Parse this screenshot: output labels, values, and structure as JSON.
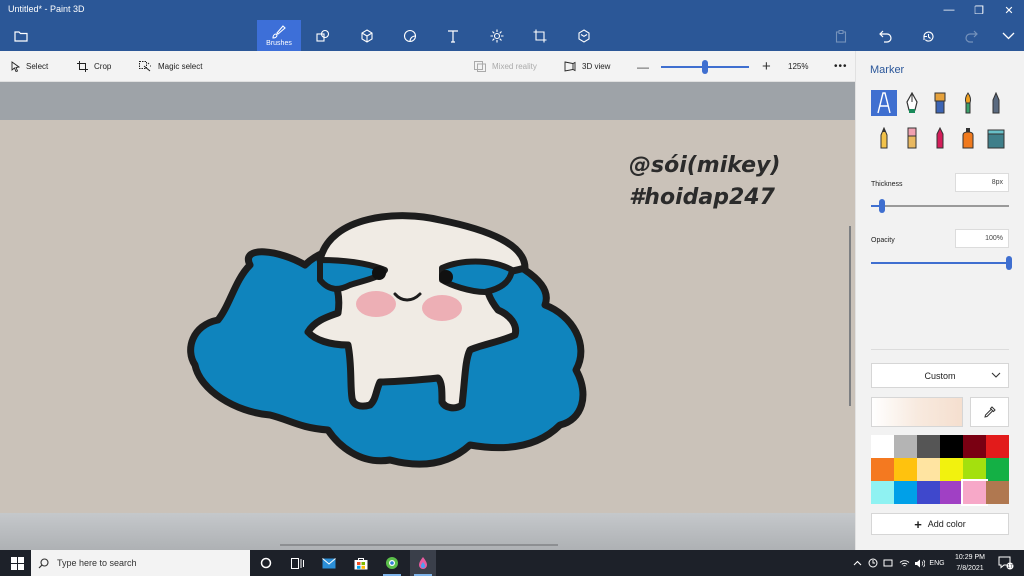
{
  "window": {
    "title": "Untitled* - Paint 3D"
  },
  "toolbar": {
    "tabs": [
      {
        "id": "brushes",
        "label": "Brushes",
        "icon": "brush-icon",
        "active": true
      },
      {
        "id": "2d-shapes",
        "icon": "2d-shapes-icon"
      },
      {
        "id": "3d-shapes",
        "icon": "3d-shapes-icon"
      },
      {
        "id": "stickers",
        "icon": "stickers-icon"
      },
      {
        "id": "text",
        "icon": "text-icon"
      },
      {
        "id": "effects",
        "icon": "effects-icon"
      },
      {
        "id": "canvas",
        "icon": "canvas-icon"
      },
      {
        "id": "3d-library",
        "icon": "3d-library-icon"
      }
    ]
  },
  "subtoolbar": {
    "select_label": "Select",
    "crop_label": "Crop",
    "magic_select_label": "Magic select",
    "mixed_reality_label": "Mixed reality",
    "view_3d_label": "3D view",
    "zoom_value": "125%",
    "zoom_level": 0.5
  },
  "canvas": {
    "watermark_line1": "@sói(mikey)",
    "watermark_line2": "#hoidap247"
  },
  "panel": {
    "title": "Marker",
    "brushes": [
      {
        "name": "marker",
        "active": true
      },
      {
        "name": "calligraphy-pen"
      },
      {
        "name": "oil-brush"
      },
      {
        "name": "watercolor"
      },
      {
        "name": "pixel-pen"
      },
      {
        "name": "pencil"
      },
      {
        "name": "eraser"
      },
      {
        "name": "crayon"
      },
      {
        "name": "spray-can"
      },
      {
        "name": "fill"
      }
    ],
    "thickness_label": "Thickness",
    "thickness_value": "8px",
    "thickness_level": 0.08,
    "opacity_label": "Opacity",
    "opacity_value": "100%",
    "opacity_level": 1.0,
    "color_mode": "Custom",
    "current_color": "#f8eadf",
    "palette": [
      "#ffffff",
      "#b4b4b4",
      "#555555",
      "#000000",
      "#7a0012",
      "#e21b1b",
      "#f47920",
      "#ffc20e",
      "#ffe4a1",
      "#f2f20e",
      "#a4e00e",
      "#14b045",
      "#8ff2f2",
      "#00a0e8",
      "#3f48cc",
      "#a040c4",
      "#f7a8c8",
      "#b07850"
    ],
    "selected_swatch_index": 16,
    "add_color_label": "Add color"
  },
  "taskbar": {
    "search_placeholder": "Type here to search",
    "language": "ENG",
    "time": "10:29 PM",
    "date": "7/8/2021",
    "notification_count": "17"
  }
}
